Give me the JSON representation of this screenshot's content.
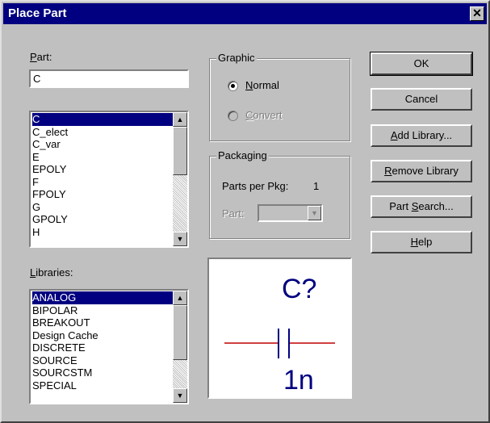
{
  "window": {
    "title": "Place Part",
    "close_glyph": "✕"
  },
  "part": {
    "label": "Part:",
    "label_hotkey": "P",
    "label_rest": "art:",
    "value": "C",
    "items": [
      "C",
      "C_elect",
      "C_var",
      "E",
      "EPOLY",
      "F",
      "FPOLY",
      "G",
      "GPOLY",
      "H"
    ],
    "selected_index": 0
  },
  "libraries": {
    "label_hotkey": "L",
    "label_rest": "ibraries:",
    "items": [
      "ANALOG",
      "BIPOLAR",
      "BREAKOUT",
      "Design Cache",
      "DISCRETE",
      "SOURCE",
      "SOURCSTM",
      "SPECIAL"
    ],
    "selected_index": 0
  },
  "graphic": {
    "legend": "Graphic",
    "normal_hotkey": "N",
    "normal_rest": "ormal",
    "normal_selected": true,
    "convert_hotkey": "C",
    "convert_rest": "onvert",
    "convert_enabled": false
  },
  "packaging": {
    "legend": "Packaging",
    "parts_per_pkg_label": "Parts per Pkg:",
    "parts_per_pkg_value": "1",
    "part_label": "Part:",
    "part_value": ""
  },
  "buttons": {
    "ok": "OK",
    "cancel": "Cancel",
    "add_library_hotkey": "A",
    "add_library_rest": "dd Library...",
    "remove_library_hotkey": "R",
    "remove_library_rest": "emove Library",
    "part_search_pre": "Part ",
    "part_search_hotkey": "S",
    "part_search_rest": "earch...",
    "help_hotkey": "H",
    "help_rest": "elp"
  },
  "preview": {
    "refdes": "C?",
    "value": "1n",
    "lead_color": "#c00000",
    "text_color": "#000080"
  },
  "icons": {
    "scroll_up": "▲",
    "scroll_down": "▼",
    "combo_down": "▼"
  }
}
